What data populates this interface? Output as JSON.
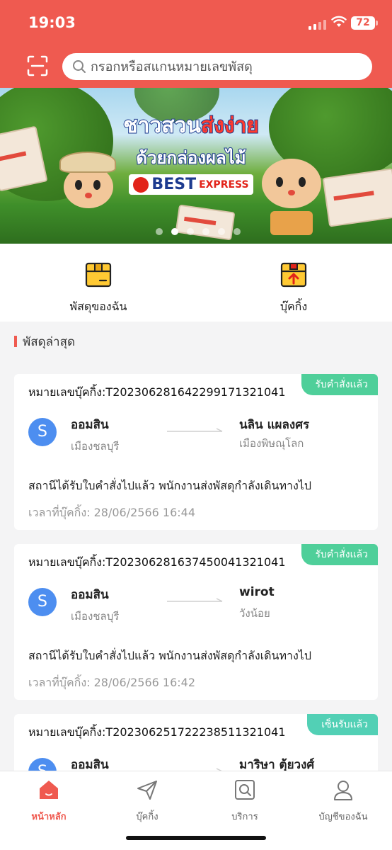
{
  "status_bar": {
    "time": "19:03",
    "battery": "72"
  },
  "search": {
    "placeholder": "กรอกหรือสแกนหมายเลขพัสดุ"
  },
  "banner": {
    "line1_a": "ชาวสวน",
    "line1_b": "ส่งง่าย",
    "line2": "ด้วยกล่องผลไม้",
    "brand": "BEST",
    "brand_suffix": "EXPRESS",
    "slide_count": 6,
    "active_slide": 2
  },
  "quick_actions": [
    {
      "label": "พัสดุของฉัน",
      "icon": "parcel-box-icon"
    },
    {
      "label": "บุ๊คกิ้ง",
      "icon": "send-box-icon"
    }
  ],
  "section": {
    "title": "พัสดุล่าสุด"
  },
  "shipments": [
    {
      "tracking": "หมายเลขบุ๊คกิ้ง:T202306281642299171321041",
      "status_badge": "รับคำสั่งแล้ว",
      "avatar": "S",
      "sender": "ออมสิน",
      "sender_location": "เมืองชลบุรี",
      "receiver": "นลิน แผลงศร",
      "receiver_location": "เมืองพิษณุโลก",
      "status_text": "สถานีได้รับใบคำสั่งไปแล้ว พนักงานส่งพัสดุกำลังเดินทางไป",
      "booking_time": "เวลาที่บุ๊คกิ้ง: 28/06/2566 16:44"
    },
    {
      "tracking": "หมายเลขบุ๊คกิ้ง:T202306281637450041321041",
      "status_badge": "รับคำสั่งแล้ว",
      "avatar": "S",
      "sender": "ออมสิน",
      "sender_location": "เมืองชลบุรี",
      "receiver": "wirot",
      "receiver_location": "วังน้อย",
      "status_text": "สถานีได้รับใบคำสั่งไปแล้ว พนักงานส่งพัสดุกำลังเดินทางไป",
      "booking_time": "เวลาที่บุ๊คกิ้ง: 28/06/2566 16:42"
    },
    {
      "tracking": "หมายเลขบุ๊คกิ้ง:T202306251722238511321041",
      "status_badge": "เซ็นรับแล้ว",
      "avatar": "S",
      "sender": "ออมสิน",
      "receiver": "มาริษา ตุ้ยวงศ์"
    }
  ],
  "bottom_nav": [
    {
      "label": "หน้าหลัก",
      "icon": "home-icon",
      "active": true
    },
    {
      "label": "บุ๊คกิ้ง",
      "icon": "send-icon",
      "active": false
    },
    {
      "label": "บริการ",
      "icon": "service-search-icon",
      "active": false
    },
    {
      "label": "บัญชีของฉัน",
      "icon": "user-icon",
      "active": false
    }
  ],
  "colors": {
    "brand": "#ef5a50",
    "badge_green": "#4fcf9a",
    "badge_teal": "#52d0b5",
    "avatar": "#4d8ef0"
  }
}
